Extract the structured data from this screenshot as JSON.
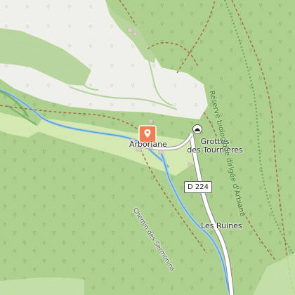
{
  "map": {
    "labels": {
      "village": "Arboriane",
      "cave_line1": "Grottes",
      "cave_line2": "des Tournières",
      "ruins": "Les Ruines",
      "trail": "Chemin des Sermonins",
      "reserve": "Réserve biologique dirigée d'Arbiane"
    },
    "road_ref": "D 224",
    "icons": {
      "marker": "location-pin-icon",
      "cave": "cave-icon",
      "trees": "tree-icon"
    },
    "colors": {
      "forest": "#aed08f",
      "clearing": "#f0f0ea",
      "meadow": "#d4e8b2",
      "water": "#aad3df",
      "river": "#5b9bd5",
      "road_fill": "#ffffff",
      "road_casing": "#888888",
      "track": "#a46843",
      "marker": "#f07e53",
      "reserve_outline": "#6ba35a"
    }
  }
}
